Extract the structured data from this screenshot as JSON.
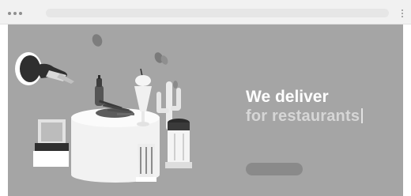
{
  "browser": {
    "address": "",
    "window_controls": [
      "close",
      "minimize",
      "maximize"
    ],
    "menu_icon": "kebab-menu-icon"
  },
  "hero": {
    "headline_line1": "We deliver",
    "headline_line2": "for restaurants",
    "subtext": "",
    "cta_label": "",
    "background_color": "#a5a5a5",
    "headline_color": "#ffffff",
    "headline_accent_color": "#d6d6d6",
    "illustration": [
      "hand-icon",
      "ketchup-bottle-icon",
      "milkshake-icon",
      "cactus-icon",
      "napkin-holder-icon",
      "salt-shaker-icon",
      "sugar-dispenser-icon",
      "fries-tray-icon",
      "coin-icon"
    ]
  }
}
